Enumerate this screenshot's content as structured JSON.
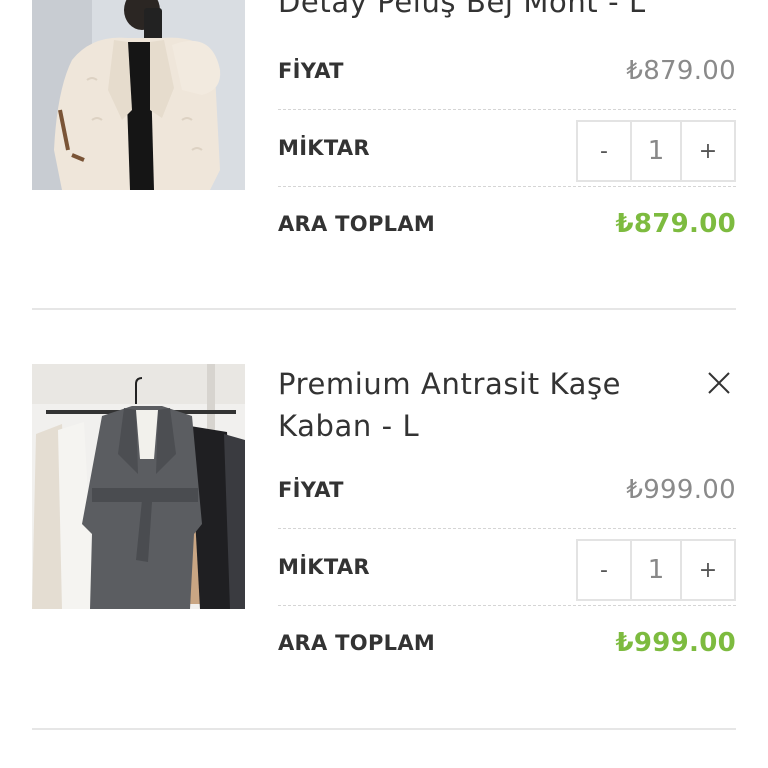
{
  "cart": {
    "items": [
      {
        "title": "Detay Peluş Bej Mont - L",
        "price_label": "FİYAT",
        "price": "₺879.00",
        "qty_label": "MİKTAR",
        "qty_minus": "-",
        "qty": "1",
        "qty_plus": "+",
        "subtotal_label": "ARA TOPLAM",
        "subtotal": "₺879.00"
      },
      {
        "title_line1": "Premium Antrasit Kaşe",
        "title_line2": "Kaban - L",
        "price_label": "FİYAT",
        "price": "₺999.00",
        "qty_label": "MİKTAR",
        "qty_minus": "-",
        "qty": "1",
        "qty_plus": "+",
        "subtotal_label": "ARA TOPLAM",
        "subtotal": "₺999.00"
      }
    ]
  },
  "colors": {
    "subtotal": "#7dbb3f",
    "price": "#8a8a8a",
    "border": "#e3e3e3"
  },
  "icons": {
    "remove": "close-icon"
  }
}
